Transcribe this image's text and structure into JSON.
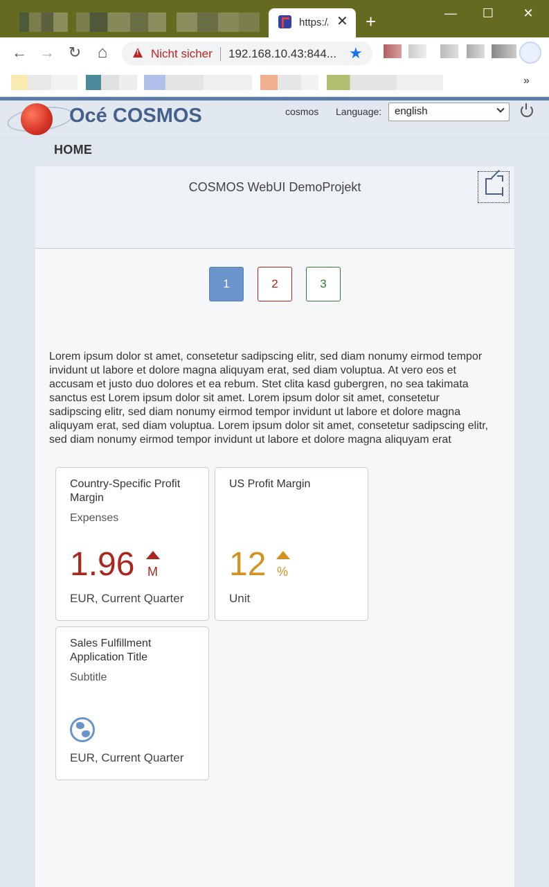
{
  "browser": {
    "tab_title": "https://",
    "tab_close": "✕",
    "new_tab": "+",
    "window_controls": {
      "minimize": "—",
      "maximize": "☐",
      "close": "✕"
    },
    "nav": {
      "back": "←",
      "forward": "→",
      "reload": "↻",
      "home": "⌂"
    },
    "security_text": "Nicht sicher",
    "url": "192.168.10.43:844...",
    "bookmarks_more": "»"
  },
  "app": {
    "brand": "Océ COSMOS",
    "user": "cosmos",
    "language_label": "Language:",
    "language_value": "english",
    "nav_home": "HOME"
  },
  "panel": {
    "title": "COSMOS WebUI DemoProjekt",
    "pages": [
      "1",
      "2",
      "3"
    ],
    "body_text": "Lorem ipsum dolor st amet, consetetur sadipscing elitr, sed diam nonumy eirmod tempor invidunt ut labore et dolore magna aliquyam erat, sed diam voluptua. At vero eos et accusam et justo duo dolores et ea rebum. Stet clita kasd gubergren, no sea takimata sanctus est Lorem ipsum dolor sit amet. Lorem ipsum dolor sit amet, consetetur sadipscing elitr, sed diam nonumy eirmod tempor invidunt ut labore et dolore magna aliquyam erat, sed diam voluptua. Lorem ipsum dolor sit amet, consetetur sadipscing elitr, sed diam nonumy eirmod tempor invidunt ut labore et dolore magna aliquyam erat"
  },
  "tiles": [
    {
      "title": "Country-Specific Profit Margin",
      "subtitle": "Expenses",
      "value": "1.96",
      "unit": "M",
      "footer": "EUR, Current Quarter",
      "color": "#a9271c"
    },
    {
      "title": "US Profit Margin",
      "subtitle": "",
      "value": "12",
      "unit": "%",
      "footer": "Unit",
      "color": "#d5901d"
    },
    {
      "title": "Sales Fulfillment Application Title",
      "subtitle": "Subtitle",
      "icon": "globe-icon",
      "footer": "EUR, Current Quarter"
    }
  ],
  "colors": {
    "titlebar": "#646a1f",
    "brand": "#45608a",
    "page_active": "#6b94cc",
    "page_red": "#b42318",
    "page_green": "#2e7d32"
  }
}
